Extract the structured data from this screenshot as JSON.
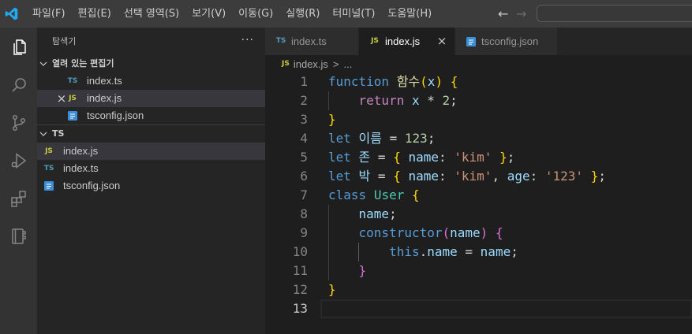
{
  "titlebar": {
    "menu": [
      "파일(F)",
      "편집(E)",
      "선택 영역(S)",
      "보기(V)",
      "이동(G)",
      "실행(R)",
      "터미널(T)",
      "도움말(H)"
    ],
    "back": "←",
    "forward": "→"
  },
  "activity_bar": {
    "items": [
      {
        "icon": "files-icon",
        "active": true
      },
      {
        "icon": "search-icon"
      },
      {
        "icon": "source-control-icon"
      },
      {
        "icon": "run-debug-icon"
      },
      {
        "icon": "extensions-icon"
      },
      {
        "icon": "book-icon"
      }
    ]
  },
  "sidebar": {
    "title": "탐색기",
    "more": "···",
    "open_editors": {
      "label": "열려 있는 편집기",
      "items": [
        {
          "badge": "TS",
          "icon": "typescript-file-icon",
          "label": "index.ts"
        },
        {
          "badge": "JS",
          "icon": "javascript-file-icon",
          "label": "index.js",
          "close": "×",
          "selected": true
        },
        {
          "icon": "tsconfig-file-icon",
          "label": "tsconfig.json"
        }
      ]
    },
    "folder": {
      "label": "TS",
      "items": [
        {
          "badge": "JS",
          "icon": "javascript-file-icon",
          "label": "index.js",
          "selected": true
        },
        {
          "badge": "TS",
          "icon": "typescript-file-icon",
          "label": "index.ts"
        },
        {
          "icon": "tsconfig-file-icon",
          "label": "tsconfig.json"
        }
      ]
    }
  },
  "editor": {
    "tabs": [
      {
        "badge": "TS",
        "icon": "typescript-file-icon",
        "label": "index.ts"
      },
      {
        "badge": "JS",
        "icon": "javascript-file-icon",
        "label": "index.js",
        "close": "×",
        "active": true
      },
      {
        "icon": "tsconfig-file-icon",
        "label": "tsconfig.json"
      }
    ],
    "breadcrumb": {
      "badge": "JS",
      "file": "index.js",
      "separator": ">",
      "symbol": "..."
    },
    "lines": [
      {
        "n": 1,
        "tokens": [
          [
            "function",
            "keyword"
          ],
          [
            " ",
            "plain"
          ],
          [
            "함수",
            "function"
          ],
          [
            "(",
            "bracket1"
          ],
          [
            "x",
            "variable"
          ],
          [
            ")",
            "bracket1"
          ],
          [
            " ",
            "plain"
          ],
          [
            "{",
            "bracket1"
          ]
        ]
      },
      {
        "n": 2,
        "tokens": [
          [
            "    ",
            "plain"
          ],
          [
            "return",
            "control"
          ],
          [
            " ",
            "plain"
          ],
          [
            "x",
            "variable"
          ],
          [
            " * ",
            "plain"
          ],
          [
            "2",
            "number"
          ],
          [
            ";",
            "plain"
          ]
        ]
      },
      {
        "n": 3,
        "tokens": [
          [
            "}",
            "bracket1"
          ]
        ]
      },
      {
        "n": 4,
        "tokens": [
          [
            "let",
            "keyword"
          ],
          [
            " ",
            "plain"
          ],
          [
            "이름",
            "variable"
          ],
          [
            " = ",
            "plain"
          ],
          [
            "123",
            "number"
          ],
          [
            ";",
            "plain"
          ]
        ]
      },
      {
        "n": 5,
        "tokens": [
          [
            "let",
            "keyword"
          ],
          [
            " ",
            "plain"
          ],
          [
            "존",
            "variable"
          ],
          [
            " = ",
            "plain"
          ],
          [
            "{",
            "bracket1"
          ],
          [
            " ",
            "plain"
          ],
          [
            "name",
            "variable"
          ],
          [
            ": ",
            "plain"
          ],
          [
            "'kim'",
            "string"
          ],
          [
            " ",
            "plain"
          ],
          [
            "}",
            "bracket1"
          ],
          [
            ";",
            "plain"
          ]
        ]
      },
      {
        "n": 6,
        "tokens": [
          [
            "let",
            "keyword"
          ],
          [
            " ",
            "plain"
          ],
          [
            "박",
            "variable"
          ],
          [
            " = ",
            "plain"
          ],
          [
            "{",
            "bracket1"
          ],
          [
            " ",
            "plain"
          ],
          [
            "name",
            "variable"
          ],
          [
            ": ",
            "plain"
          ],
          [
            "'kim'",
            "string"
          ],
          [
            ", ",
            "plain"
          ],
          [
            "age",
            "variable"
          ],
          [
            ": ",
            "plain"
          ],
          [
            "'123'",
            "string"
          ],
          [
            " ",
            "plain"
          ],
          [
            "}",
            "bracket1"
          ],
          [
            ";",
            "plain"
          ]
        ]
      },
      {
        "n": 7,
        "tokens": [
          [
            "class",
            "keyword"
          ],
          [
            " ",
            "plain"
          ],
          [
            "User",
            "class"
          ],
          [
            " ",
            "plain"
          ],
          [
            "{",
            "bracket1"
          ]
        ]
      },
      {
        "n": 8,
        "tokens": [
          [
            "    ",
            "plain"
          ],
          [
            "name",
            "variable"
          ],
          [
            ";",
            "plain"
          ]
        ]
      },
      {
        "n": 9,
        "tokens": [
          [
            "    ",
            "plain"
          ],
          [
            "constructor",
            "keyword"
          ],
          [
            "(",
            "bracket2"
          ],
          [
            "name",
            "variable"
          ],
          [
            ")",
            "bracket2"
          ],
          [
            " ",
            "plain"
          ],
          [
            "{",
            "bracket2"
          ]
        ]
      },
      {
        "n": 10,
        "tokens": [
          [
            "        ",
            "plain"
          ],
          [
            "this",
            "keyword"
          ],
          [
            ".",
            "plain"
          ],
          [
            "name",
            "variable"
          ],
          [
            " = ",
            "plain"
          ],
          [
            "name",
            "variable"
          ],
          [
            ";",
            "plain"
          ]
        ]
      },
      {
        "n": 11,
        "tokens": [
          [
            "    ",
            "plain"
          ],
          [
            "}",
            "bracket2"
          ]
        ]
      },
      {
        "n": 12,
        "tokens": [
          [
            "}",
            "bracket1"
          ]
        ]
      },
      {
        "n": 13,
        "tokens": [],
        "current": true
      }
    ]
  },
  "theme": {
    "logo_blue": "#23a9f2",
    "ts_badge": "#519aba",
    "js_badge": "#cbcb41",
    "tsconfig_icon": "#3c8fd6",
    "selection_bg": "#37373d",
    "syntax": {
      "keyword": "#569cd6",
      "control": "#c586c0",
      "function": "#dcdcaa",
      "variable": "#9cdcfe",
      "number": "#b5cea8",
      "string": "#ce9178",
      "class": "#4ec9b0",
      "bracket1": "#ffd700",
      "bracket2": "#da70d6",
      "plain": "#d4d4d4"
    }
  }
}
